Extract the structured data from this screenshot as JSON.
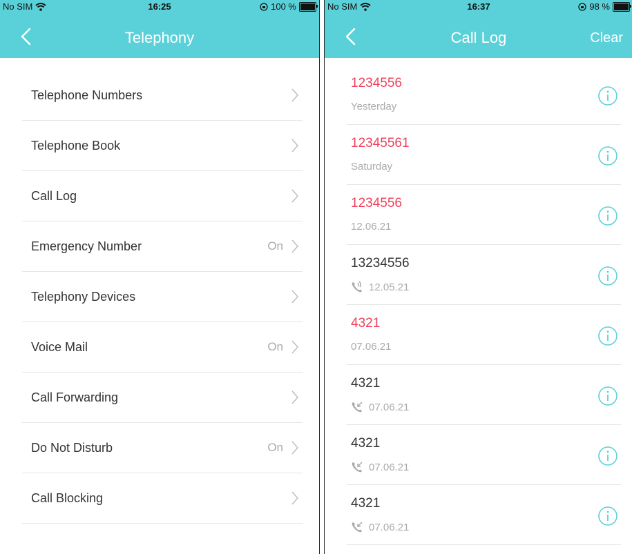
{
  "colors": {
    "accent": "#5ad1d8",
    "missed": "#f0405c",
    "secondary": "#aaaaaa"
  },
  "left_screen": {
    "status": {
      "carrier": "No SIM",
      "time": "16:25",
      "battery": "100 %",
      "battery_level": 1.0
    },
    "nav": {
      "back_icon": "chevron-left-icon",
      "title": "Telephony"
    },
    "menu": [
      {
        "label": "Telephone Numbers",
        "value": ""
      },
      {
        "label": "Telephone Book",
        "value": ""
      },
      {
        "label": "Call Log",
        "value": ""
      },
      {
        "label": "Emergency Number",
        "value": "On"
      },
      {
        "label": "Telephony Devices",
        "value": ""
      },
      {
        "label": "Voice Mail",
        "value": "On"
      },
      {
        "label": "Call Forwarding",
        "value": ""
      },
      {
        "label": "Do Not Disturb",
        "value": "On"
      },
      {
        "label": "Call Blocking",
        "value": ""
      }
    ]
  },
  "right_screen": {
    "status": {
      "carrier": "No SIM",
      "time": "16:37",
      "battery": "98 %",
      "battery_level": 0.98
    },
    "nav": {
      "back_icon": "chevron-left-icon",
      "title": "Call Log",
      "action": "Clear"
    },
    "calls": [
      {
        "number": "1234556",
        "date": "Yesterday",
        "status": "missed",
        "icon": ""
      },
      {
        "number": "12345561",
        "date": "Saturday",
        "status": "missed",
        "icon": ""
      },
      {
        "number": "1234556",
        "date": "12.06.21",
        "status": "missed",
        "icon": ""
      },
      {
        "number": "13234556",
        "date": "12.05.21",
        "status": "outgoing",
        "icon": "phone-outgoing-icon"
      },
      {
        "number": "4321",
        "date": "07.06.21",
        "status": "missed",
        "icon": ""
      },
      {
        "number": "4321",
        "date": "07.06.21",
        "status": "incoming",
        "icon": "phone-incoming-icon"
      },
      {
        "number": "4321",
        "date": "07.06.21",
        "status": "incoming",
        "icon": "phone-incoming-icon"
      },
      {
        "number": "4321",
        "date": "07.06.21",
        "status": "incoming",
        "icon": "phone-incoming-icon"
      }
    ]
  }
}
